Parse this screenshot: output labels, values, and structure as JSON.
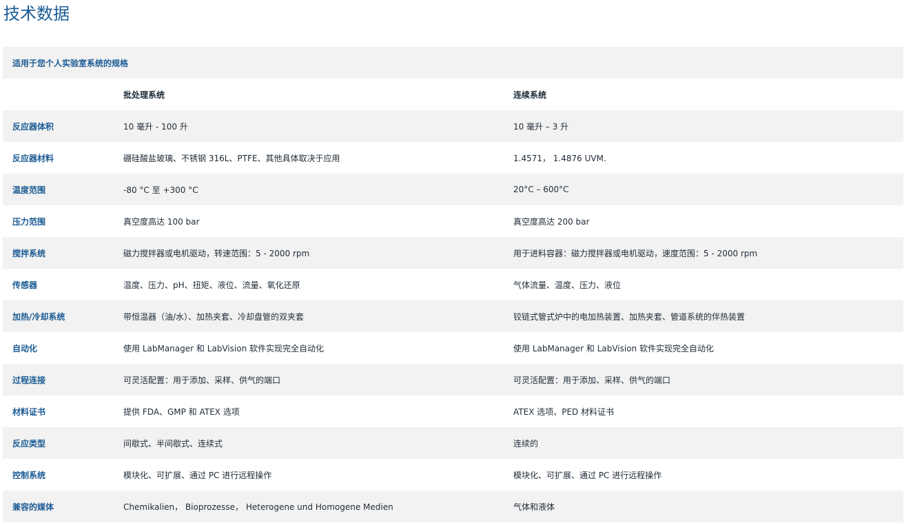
{
  "page": {
    "title": "技术数据"
  },
  "table": {
    "caption": "适用于您个人实验室系统的规格",
    "columns": [
      "批处理系统",
      "连续系统"
    ],
    "rows": [
      {
        "label": "反应器体积",
        "batch": "10 毫升 - 100 升",
        "continuous": "10 毫升 – 3 升"
      },
      {
        "label": "反应器材料",
        "batch": "硼硅酸盐玻璃、不锈钢 316L、PTFE、其他具体取决于应用",
        "continuous": "1.4571， 1.4876 UVM."
      },
      {
        "label": "温度范围",
        "batch": "-80 °C 至 +300 °C",
        "continuous": "20°C – 600°C"
      },
      {
        "label": "压力范围",
        "batch": "真空度高达 100 bar",
        "continuous": "真空度高达 200 bar"
      },
      {
        "label": "搅拌系统",
        "batch": "磁力搅拌器或电机驱动，转速范围：5 - 2000 rpm",
        "continuous": "用于进料容器：磁力搅拌器或电机驱动，速度范围：5 - 2000 rpm"
      },
      {
        "label": "传感器",
        "batch": "温度、压力、pH、扭矩、液位、流量、氧化还原",
        "continuous": "气体流量、温度、压力、液位"
      },
      {
        "label": "加热/冷却系统",
        "batch": "带恒温器（油/水）、加热夹套、冷却盘管的双夹套",
        "continuous": "铰链式管式炉中的电加热装置、加热夹套、管道系统的伴热装置"
      },
      {
        "label": "自动化",
        "batch": "使用 LabManager 和 LabVision 软件实现完全自动化",
        "continuous": "使用 LabManager 和 LabVision 软件实现完全自动化"
      },
      {
        "label": "过程连接",
        "batch": "可灵活配置：用于添加、采样、供气的端口",
        "continuous": "可灵活配置：用于添加、采样、供气的端口"
      },
      {
        "label": "材料证书",
        "batch": "提供 FDA、GMP 和 ATEX 选项",
        "continuous": "ATEX 选项、PED 材料证书"
      },
      {
        "label": "反应类型",
        "batch": "间歇式、半间歇式、连续式",
        "continuous": "连续的"
      },
      {
        "label": "控制系统",
        "batch": "模块化、可扩展、通过 PC 进行远程操作",
        "continuous": "模块化、可扩展、通过 PC 进行远程操作"
      },
      {
        "label": "兼容的媒体",
        "batch": "Chemikalien， Bioprozesse， Heterogene und Homogene Medien",
        "continuous": "气体和液体"
      }
    ]
  },
  "colors": {
    "accent": "#1b5c94",
    "text": "#1e2a36",
    "stripe": "#f2f2f2"
  }
}
